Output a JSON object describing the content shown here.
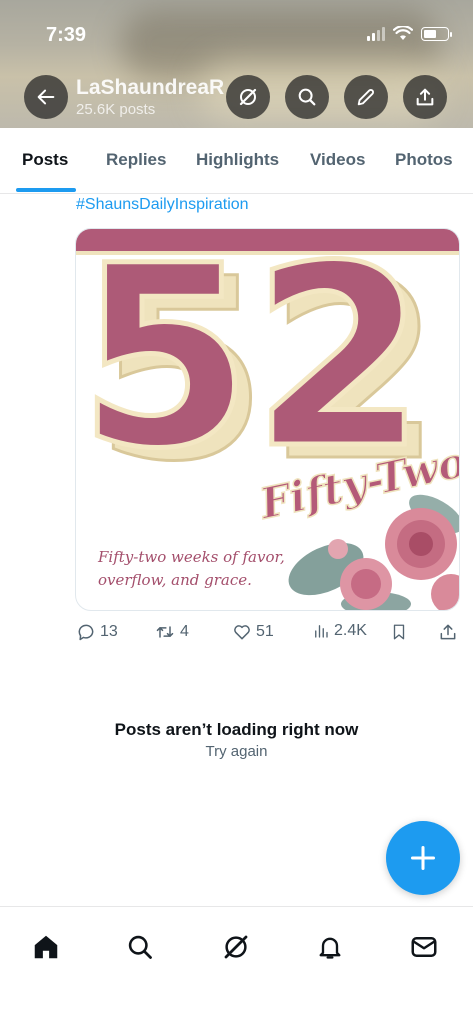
{
  "status_bar": {
    "time": "7:39"
  },
  "profile": {
    "name": "LaShaundreaR",
    "posts_count": "25.6K posts"
  },
  "header_icons": [
    "back-arrow-icon",
    "grok-icon",
    "search-icon",
    "compose-icon",
    "share-icon"
  ],
  "tabs": [
    {
      "label": "Posts",
      "active": true
    },
    {
      "label": "Replies",
      "active": false
    },
    {
      "label": "Highlights",
      "active": false
    },
    {
      "label": "Videos",
      "active": false
    },
    {
      "label": "Photos",
      "active": false
    }
  ],
  "post": {
    "hashtag": "#ShaunsDailyInspiration",
    "image": {
      "number": "52",
      "script_title": "Fifty-Two",
      "caption_line1": "Fifty-two weeks of favor,",
      "caption_line2": "overflow, and grace."
    },
    "actions": {
      "replies": "13",
      "reposts": "4",
      "likes": "51",
      "views": "2.4K"
    }
  },
  "error": {
    "title": "Posts aren’t loading right now",
    "retry": "Try again"
  },
  "bottom_nav": [
    "home-icon",
    "search-icon",
    "grok-icon",
    "notifications-icon",
    "messages-icon"
  ],
  "colors": {
    "accent": "#1d9bf0",
    "rose": "#b05a78",
    "cream": "#efe3bd"
  }
}
